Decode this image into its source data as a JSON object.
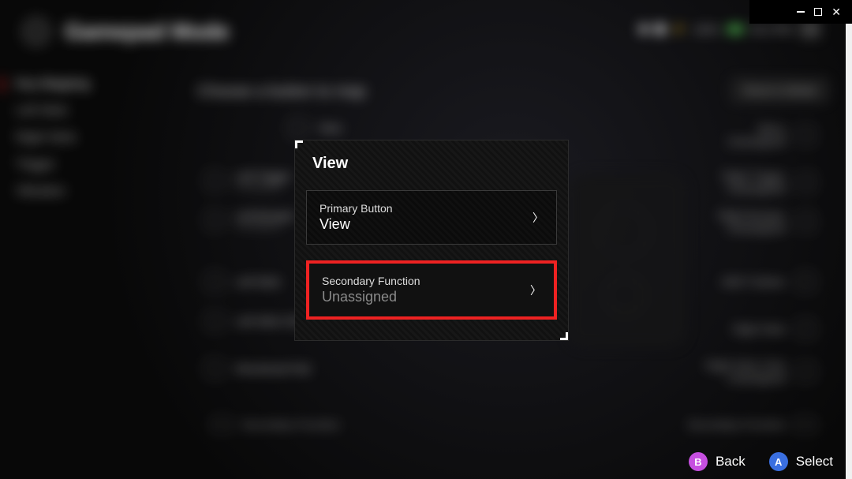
{
  "header": {
    "title": "Gamepad Mode",
    "battery_pct": "100%",
    "time": "06:17PM"
  },
  "sidebar": {
    "items": [
      {
        "label": "Key Mapping",
        "active": true
      },
      {
        "label": "Left Stick"
      },
      {
        "label": "Right Stick"
      },
      {
        "label": "Trigger"
      },
      {
        "label": "Vibration"
      }
    ]
  },
  "main": {
    "heading": "Choose a button to map",
    "reset_label": "Reset to Default"
  },
  "bg_buttons": {
    "view": {
      "label": "View",
      "sub": ""
    },
    "menu": {
      "label": "Menu",
      "sub": "Unassigned"
    },
    "left_trigger": {
      "label": "Left Trigger",
      "sub": "Unassigned"
    },
    "left_bumper": {
      "label": "Left Bumper",
      "sub": "Unassigned"
    },
    "left_stick": {
      "label": "Left Stick",
      "sub": ""
    },
    "left_stick_click": {
      "label": "Left Stick Click",
      "sub": ""
    },
    "directional_pad": {
      "label": "Directional Pad",
      "sub": ""
    },
    "right_trigger": {
      "label": "Right Trigger",
      "sub": "Unassigned"
    },
    "right_bumper": {
      "label": "Right Bumper",
      "sub": "Unassigned"
    },
    "abxy": {
      "label": "ABXY Button",
      "sub": ""
    },
    "right_stick": {
      "label": "Right Stick",
      "sub": ""
    },
    "right_stick_click": {
      "label": "Right Stick Click",
      "sub": "Unassigned"
    },
    "secondary_left": "Secondary Function",
    "secondary_right": "Secondary Function"
  },
  "modal": {
    "title": "View",
    "primary": {
      "label": "Primary Button",
      "value": "View"
    },
    "secondary": {
      "label": "Secondary Function",
      "value": "Unassigned"
    }
  },
  "footer": {
    "back_label": "Back",
    "select_label": "Select"
  }
}
